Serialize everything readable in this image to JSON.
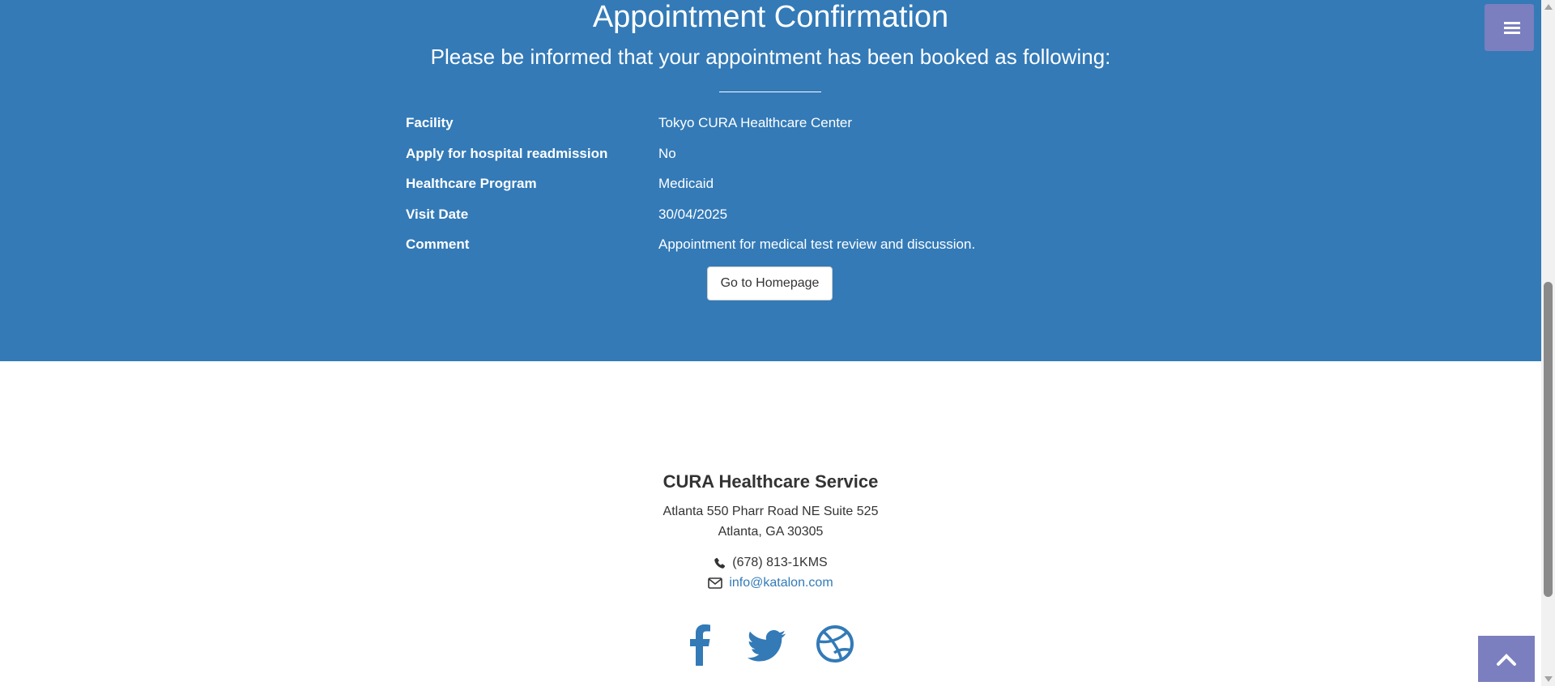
{
  "confirmation": {
    "title": "Appointment Confirmation",
    "subtitle": "Please be informed that your appointment has been booked as following:",
    "rows": [
      {
        "label": "Facility",
        "value": "Tokyo CURA Healthcare Center"
      },
      {
        "label": "Apply for hospital readmission",
        "value": "No"
      },
      {
        "label": "Healthcare Program",
        "value": "Medicaid"
      },
      {
        "label": "Visit Date",
        "value": "30/04/2025"
      },
      {
        "label": "Comment",
        "value": "Appointment for medical test review and discussion."
      }
    ],
    "home_button_label": "Go to Homepage"
  },
  "footer": {
    "company": "CURA Healthcare Service",
    "address_line1": "Atlanta 550 Pharr Road NE Suite 525",
    "address_line2": "Atlanta, GA 30305",
    "phone": "(678) 813-1KMS",
    "email": "info@katalon.com",
    "social_icons": [
      "facebook-icon",
      "twitter-icon",
      "dribbble-icon"
    ]
  },
  "colors": {
    "hero_bg": "#337ab7",
    "accent_button": "#7b7fbf",
    "link": "#337ab7"
  },
  "icons": {
    "menu": "hamburger-icon",
    "scroll_top": "chevron-up-icon",
    "phone": "phone-icon",
    "email": "envelope-icon"
  }
}
